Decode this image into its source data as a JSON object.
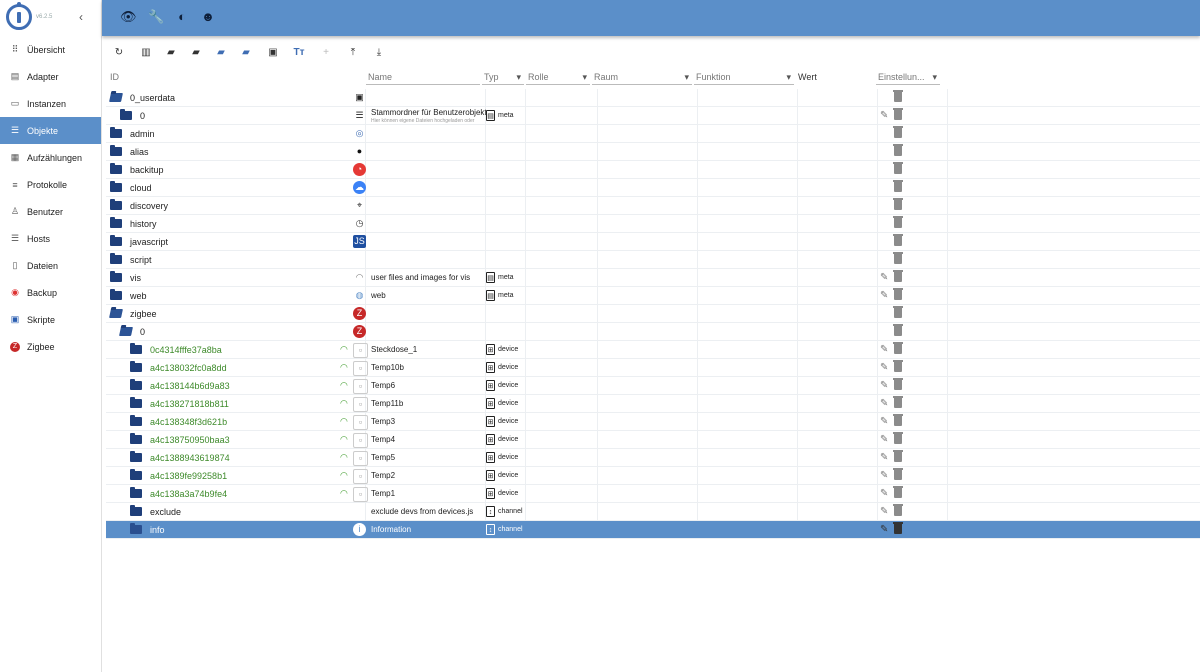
{
  "sidebar": {
    "version": "v6.2.5",
    "items": [
      {
        "label": "Übersicht",
        "icon": "grid-icon",
        "active": false
      },
      {
        "label": "Adapter",
        "icon": "store-icon",
        "active": false
      },
      {
        "label": "Instanzen",
        "icon": "instances-icon",
        "active": false
      },
      {
        "label": "Objekte",
        "icon": "list-icon",
        "active": true
      },
      {
        "label": "Aufzählungen",
        "icon": "enum-icon",
        "active": false
      },
      {
        "label": "Protokolle",
        "icon": "log-icon",
        "active": false
      },
      {
        "label": "Benutzer",
        "icon": "user-icon",
        "active": false
      },
      {
        "label": "Hosts",
        "icon": "hosts-icon",
        "active": false
      },
      {
        "label": "Dateien",
        "icon": "file-icon",
        "active": false
      },
      {
        "label": "Backup",
        "icon": "backup-icon",
        "active": false
      },
      {
        "label": "Skripte",
        "icon": "scripts-icon",
        "active": false
      },
      {
        "label": "Zigbee",
        "icon": "zigbee-icon",
        "active": false
      }
    ]
  },
  "columns": {
    "id": "ID",
    "name": "Name",
    "typ": "Typ",
    "rolle": "Rolle",
    "raum": "Raum",
    "funktion": "Funktion",
    "wert": "Wert",
    "einstellungen": "Einstellun..."
  },
  "colors": {
    "accent": "#5b8fc9",
    "folder": "#1f3f7a",
    "green": "#3d8a2a"
  },
  "rows": [
    {
      "id": "0_userdata",
      "level": 0,
      "open": true,
      "icon": "image-icon",
      "name": "",
      "typ": "",
      "edit": false
    },
    {
      "id": "0",
      "level": 1,
      "open": false,
      "icon": "document-icon",
      "name": "Stammordner für Benutzerobjekte",
      "sub": "Hier können eigene Dateien hochgeladen oder",
      "typ": "meta",
      "edit": true
    },
    {
      "id": "admin",
      "level": 0,
      "open": false,
      "icon": "iobroker-icon",
      "name": "",
      "typ": "",
      "edit": false
    },
    {
      "id": "alias",
      "level": 0,
      "open": false,
      "icon": "bulb-icon",
      "name": "",
      "typ": "",
      "edit": false
    },
    {
      "id": "backitup",
      "level": 0,
      "open": false,
      "icon": "backup-icon",
      "name": "",
      "typ": "",
      "edit": false
    },
    {
      "id": "cloud",
      "level": 0,
      "open": false,
      "icon": "cloud-icon",
      "name": "",
      "typ": "",
      "edit": false
    },
    {
      "id": "discovery",
      "level": 0,
      "open": false,
      "icon": "binoculars-icon",
      "name": "",
      "typ": "",
      "edit": false
    },
    {
      "id": "history",
      "level": 0,
      "open": false,
      "icon": "clock-icon",
      "name": "",
      "typ": "",
      "edit": false
    },
    {
      "id": "javascript",
      "level": 0,
      "open": false,
      "icon": "js-icon",
      "name": "",
      "typ": "",
      "edit": false
    },
    {
      "id": "script",
      "level": 0,
      "open": false,
      "icon": "",
      "name": "",
      "typ": "",
      "edit": false
    },
    {
      "id": "vis",
      "level": 0,
      "open": false,
      "icon": "vis-icon",
      "name": "user files and images for vis",
      "typ": "meta",
      "edit": true
    },
    {
      "id": "web",
      "level": 0,
      "open": false,
      "icon": "web-icon",
      "name": "web",
      "typ": "meta",
      "edit": true
    },
    {
      "id": "zigbee",
      "level": 0,
      "open": true,
      "icon": "zigbee-icon",
      "name": "",
      "typ": "",
      "edit": false
    },
    {
      "id": "0",
      "level": 1,
      "open": true,
      "icon": "zigbee-icon",
      "name": "",
      "typ": "",
      "edit": false
    },
    {
      "id": "0c4314fffe37a8ba",
      "level": 2,
      "green": true,
      "wifi": true,
      "icon": "broken-image-icon",
      "name": "Steckdose_1",
      "typ": "device",
      "edit": true
    },
    {
      "id": "a4c138032fc0a8dd",
      "level": 2,
      "green": true,
      "wifi": true,
      "icon": "broken-image-icon",
      "name": "Temp10b",
      "typ": "device",
      "edit": true
    },
    {
      "id": "a4c138144b6d9a83",
      "level": 2,
      "green": true,
      "wifi": true,
      "icon": "broken-image-icon",
      "name": "Temp6",
      "typ": "device",
      "edit": true
    },
    {
      "id": "a4c138271818b811",
      "level": 2,
      "green": true,
      "wifi": true,
      "icon": "broken-image-icon",
      "name": "Temp11b",
      "typ": "device",
      "edit": true
    },
    {
      "id": "a4c138348f3d621b",
      "level": 2,
      "green": true,
      "wifi": true,
      "icon": "broken-image-icon",
      "name": "Temp3",
      "typ": "device",
      "edit": true
    },
    {
      "id": "a4c138750950baa3",
      "level": 2,
      "green": true,
      "wifi": true,
      "icon": "broken-image-icon",
      "name": "Temp4",
      "typ": "device",
      "edit": true
    },
    {
      "id": "a4c1388943619874",
      "level": 2,
      "green": true,
      "wifi": true,
      "icon": "broken-image-icon",
      "name": "Temp5",
      "typ": "device",
      "edit": true
    },
    {
      "id": "a4c1389fe99258b1",
      "level": 2,
      "green": true,
      "wifi": true,
      "icon": "broken-image-icon",
      "name": "Temp2",
      "typ": "device",
      "edit": true
    },
    {
      "id": "a4c138a3a74b9fe4",
      "level": 2,
      "green": true,
      "wifi": true,
      "icon": "broken-image-icon",
      "name": "Temp1",
      "typ": "device",
      "edit": true
    },
    {
      "id": "exclude",
      "level": 2,
      "icon": "",
      "name": "exclude devs from devices.js",
      "typ": "channel",
      "edit": true
    },
    {
      "id": "info",
      "level": 2,
      "selected": true,
      "icon": "info-icon",
      "name": "Information",
      "typ": "channel",
      "edit": true
    }
  ]
}
